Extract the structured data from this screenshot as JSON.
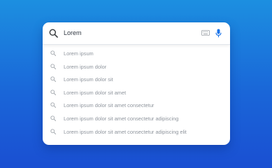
{
  "search": {
    "query": "Lorem"
  },
  "suggestions": [
    "Lorem ipsum",
    "Lorem ipsum dolor",
    "Lorem ipsum dolor sit",
    "Lorem ipsum dolor sit amet",
    "Lorem ipsum dolor sit amet consectetur",
    "Lorem ipsum dolor sit amet consectetur adipiscing",
    "Lorem ipsum dolor sit amet consectetur adipiscing elit"
  ],
  "icons": {
    "search": "search-icon",
    "keyboard": "keyboard-icon",
    "mic": "microphone-icon",
    "suggestion": "search-icon"
  },
  "colors": {
    "background_top": "#1c8fe0",
    "background_bottom": "#1a4fd2",
    "mic_accent": "#1a73e8",
    "suggestion_text": "#8f959d"
  }
}
